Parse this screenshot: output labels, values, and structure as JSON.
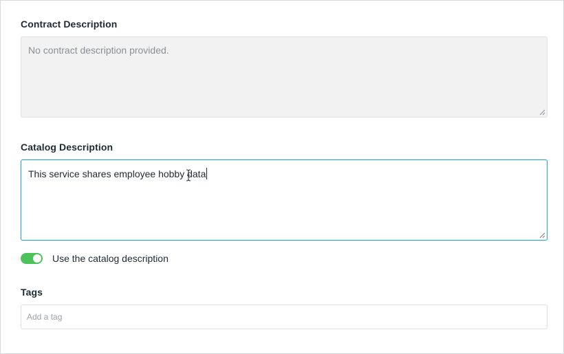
{
  "contract": {
    "label": "Contract Description",
    "value": "No contract description provided."
  },
  "catalog": {
    "label": "Catalog Description",
    "value": "This service shares employee hobby data"
  },
  "use_catalog": {
    "label": "Use the catalog description",
    "enabled": true,
    "color": "#4bc35a"
  },
  "tags": {
    "label": "Tags",
    "placeholder": "Add a tag"
  },
  "colors": {
    "focus_border": "#2fa6c8",
    "readonly_bg": "#f2f2f2"
  },
  "icons": {
    "resize_grip": "resize-grip-icon",
    "text_cursor": "i-beam-cursor-icon"
  }
}
